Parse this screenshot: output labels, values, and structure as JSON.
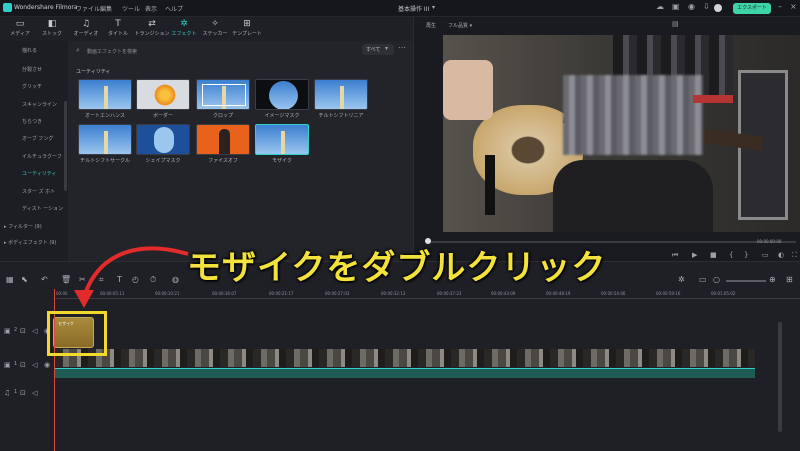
{
  "app": {
    "title": "Wondershare Filmora",
    "project": "基本操作 III",
    "export": "エクスポート"
  },
  "menu": [
    "ファイル",
    "編集",
    "ツール",
    "表示",
    "ヘルプ"
  ],
  "toolbar": {
    "items": [
      {
        "label": "メディア",
        "icon": "folder-icon",
        "glyph": "▭"
      },
      {
        "label": "ストック",
        "icon": "stock-icon",
        "glyph": "◧"
      },
      {
        "label": "オーディオ",
        "icon": "music-icon",
        "glyph": "♫"
      },
      {
        "label": "タイトル",
        "icon": "text-icon",
        "glyph": "T"
      },
      {
        "label": "トランジション",
        "icon": "transition-icon",
        "glyph": "⇄"
      },
      {
        "label": "エフェクト",
        "icon": "effects-icon",
        "glyph": "✲"
      },
      {
        "label": "ステッカー",
        "icon": "sticker-icon",
        "glyph": "✧"
      },
      {
        "label": "テンプレート",
        "icon": "template-icon",
        "glyph": "⊞"
      }
    ],
    "active": "エフェクト"
  },
  "sidebar": {
    "items": [
      "揺れる",
      "分裂させ",
      "グリッチ",
      "スキャンライン",
      "ちらつき",
      "オーブ フング",
      "イルチュラクーフ",
      "ユーティリティ",
      "スター ズ ホト",
      "ディスト ーション"
    ],
    "active": "ユーティリティ",
    "groups": [
      "フィルター",
      "ボディエフェクト"
    ],
    "group_badges": [
      "(9)",
      "(9)"
    ]
  },
  "browser": {
    "search_placeholder": "動画エフェクトを検索",
    "filter_label": "すべて",
    "section_title": "ユーティリティ",
    "effects": [
      "オートエンハンス",
      "ボーダー",
      "クロップ",
      "イメージマスク",
      "チルトシフトリニア",
      "チルトシフトサークル",
      "シェイプマスク",
      "ファイスオフ",
      "モザイク"
    ]
  },
  "viewer": {
    "mode": "再生",
    "quality": "フル品質",
    "timecode": "00:00:00:00"
  },
  "timeline": {
    "times": [
      "00:00",
      "00:00:05:11",
      "00:00:10:21",
      "00:00:16:07",
      "00:00:21:17",
      "00:00:27:03",
      "00:00:32:13",
      "00:00:37:23",
      "00:00:43:09",
      "00:00:48:19",
      "00:00:54:06",
      "00:00:59:16",
      "00:01:05:02",
      "00:01:10:12",
      "00:01:15:22"
    ],
    "effect_clip_label": "モザイク",
    "track_numbers": [
      "2",
      "1",
      "1"
    ]
  },
  "callout": "モザイクをダブルクリック",
  "colors": {
    "accent": "#2fd0c8",
    "callout": "#f4e23c",
    "arrow": "#e32b2b",
    "export": "#3fd3a6"
  }
}
